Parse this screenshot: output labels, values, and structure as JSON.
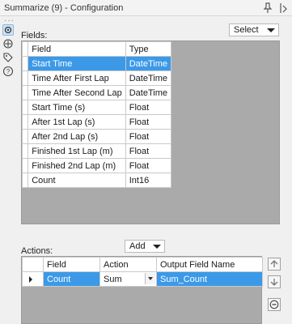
{
  "window": {
    "title": "Summarize (9) - Configuration",
    "pin_icon": "pin-icon",
    "overflow_icon": "chevron-down-icon"
  },
  "rail": {
    "items": [
      "gear-icon",
      "annotation-icon",
      "tag-icon",
      "help-icon"
    ]
  },
  "fields_section": {
    "label": "Fields:",
    "select_label": "Select",
    "columns": [
      "Field",
      "Type"
    ],
    "rows": [
      {
        "field": "Start Time",
        "type": "DateTime",
        "selected": true
      },
      {
        "field": "Time After First Lap",
        "type": "DateTime"
      },
      {
        "field": "Time After Second Lap",
        "type": "DateTime"
      },
      {
        "field": "Start Time (s)",
        "type": "Float"
      },
      {
        "field": "After 1st Lap (s)",
        "type": "Float"
      },
      {
        "field": "After 2nd Lap (s)",
        "type": "Float"
      },
      {
        "field": "Finished 1st Lap (m)",
        "type": "Float"
      },
      {
        "field": "Finished 2nd Lap (m)",
        "type": "Float"
      },
      {
        "field": "Count",
        "type": "Int16"
      }
    ]
  },
  "actions_section": {
    "label": "Actions:",
    "add_label": "Add",
    "columns": [
      "Field",
      "Action",
      "Output Field Name"
    ],
    "rows": [
      {
        "field": "Count",
        "action": "Sum",
        "output": "Sum_Count",
        "selected": true
      }
    ],
    "buttons": [
      "move-up-icon",
      "move-down-icon",
      "remove-icon"
    ]
  },
  "colors": {
    "selection": "#3b99e8",
    "grid_background": "#aaaaaa"
  }
}
